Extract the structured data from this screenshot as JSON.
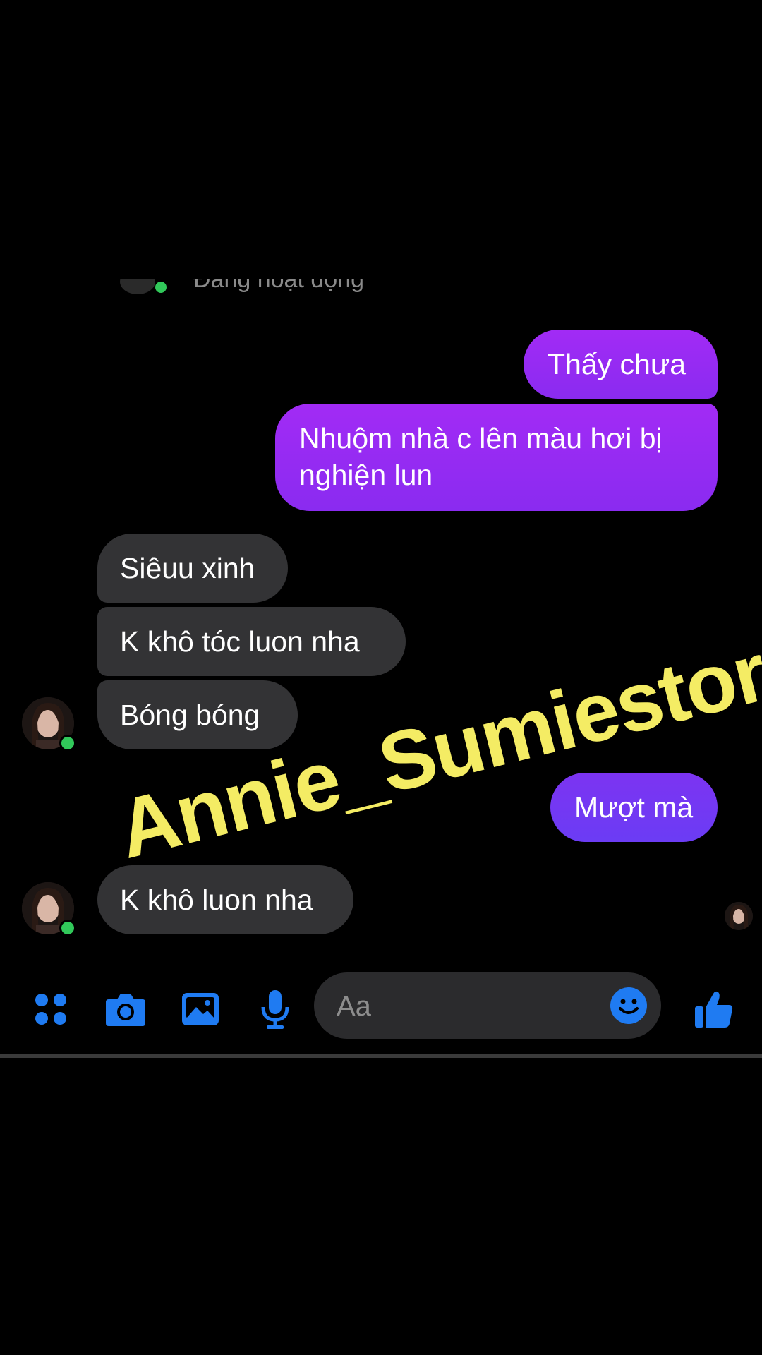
{
  "chat": {
    "status_text": "Đang hoạt động",
    "messages": [
      {
        "id": "m1",
        "direction": "outgoing",
        "text": "Thấy chưa"
      },
      {
        "id": "m2",
        "direction": "outgoing",
        "text": "Nhuộm nhà c lên màu hơi bị nghiện lun"
      },
      {
        "id": "m3",
        "direction": "incoming",
        "text": "Siêuu xinh"
      },
      {
        "id": "m4",
        "direction": "incoming",
        "text": "K khô tóc luon nha"
      },
      {
        "id": "m5",
        "direction": "incoming",
        "text": "Bóng bóng"
      },
      {
        "id": "m6",
        "direction": "outgoing",
        "text": "Mượt mà"
      },
      {
        "id": "m7",
        "direction": "incoming",
        "text": "K khô luon nha"
      }
    ]
  },
  "watermark": {
    "text": "Annie_Sumiestore"
  },
  "composer": {
    "placeholder": "Aa"
  },
  "toolbar": {
    "icons": [
      "menu-dots-icon",
      "camera-icon",
      "image-icon",
      "microphone-icon",
      "emoji-icon",
      "like-icon"
    ]
  },
  "colors": {
    "background": "#000000",
    "outgoing_bubble": "#9b2cf5",
    "incoming_bubble": "#333335",
    "accent_blue": "#1f7bf2",
    "online_green": "#31c85a",
    "watermark": "#f4ec64"
  }
}
